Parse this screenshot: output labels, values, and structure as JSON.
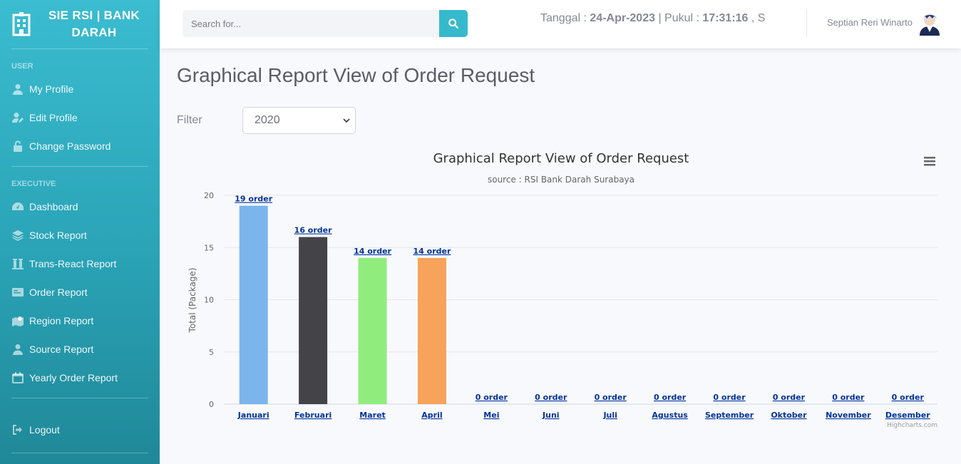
{
  "app": {
    "brand_line1": "SIE RSI | BANK",
    "brand_line2": "DARAH"
  },
  "sidebar": {
    "sections": [
      {
        "heading": "USER",
        "items": [
          {
            "label": "My Profile",
            "icon": "user-icon"
          },
          {
            "label": "Edit Profile",
            "icon": "user-edit-icon"
          },
          {
            "label": "Change Password",
            "icon": "lock-icon"
          }
        ]
      },
      {
        "heading": "EXECUTIVE",
        "items": [
          {
            "label": "Dashboard",
            "icon": "dashboard-icon"
          },
          {
            "label": "Stock Report",
            "icon": "layers-icon"
          },
          {
            "label": "Trans-React Report",
            "icon": "vials-icon"
          },
          {
            "label": "Order Report",
            "icon": "receipt-icon"
          },
          {
            "label": "Region Report",
            "icon": "map-icon"
          },
          {
            "label": "Source Report",
            "icon": "user-md-icon"
          },
          {
            "label": "Yearly Order Report",
            "icon": "calendar-icon"
          }
        ]
      }
    ],
    "logout_label": "Logout"
  },
  "topbar": {
    "search_placeholder": "Search for...",
    "date_label": "Tanggal : ",
    "date_value": "24-Apr-2023",
    "time_label": " | Pukul : ",
    "time_value": "17:31:16",
    "time_suffix": " , S",
    "user_name": "Septian Reri Winarto"
  },
  "page": {
    "title": "Graphical Report View of Order Request",
    "filter_label": "Filter",
    "filter_value": "2020"
  },
  "colors": {
    "accent": "#36b9cc",
    "bars": [
      "#7cb5ec",
      "#434348",
      "#90ed7d",
      "#f7a35c"
    ]
  },
  "chart_data": {
    "type": "bar",
    "title": "Graphical Report View of Order Request",
    "subtitle": "source : RSI Bank Darah Surabaya",
    "ylabel": "Total (Package)",
    "ylim": [
      0,
      20
    ],
    "yticks": [
      0,
      5,
      10,
      15,
      20
    ],
    "categories": [
      "Januari",
      "Februari",
      "Maret",
      "April",
      "Mei",
      "Juni",
      "Juli",
      "Agustus",
      "September",
      "Oktober",
      "November",
      "Desember"
    ],
    "values": [
      19,
      16,
      14,
      14,
      0,
      0,
      0,
      0,
      0,
      0,
      0,
      0
    ],
    "data_labels": [
      "19 order",
      "16 order",
      "14 order",
      "14 order",
      "0 order",
      "0 order",
      "0 order",
      "0 order",
      "0 order",
      "0 order",
      "0 order",
      "0 order"
    ],
    "credits": "Highcharts.com",
    "grid": true,
    "legend": "none"
  }
}
